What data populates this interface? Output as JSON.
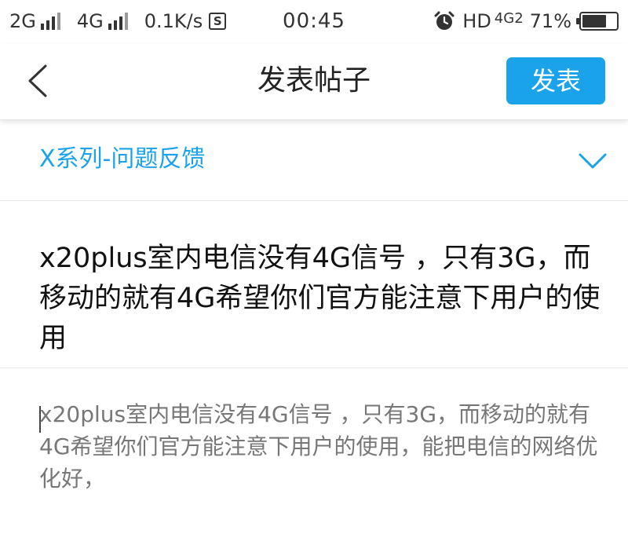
{
  "status_bar": {
    "network1": "2G",
    "network2": "4G",
    "speed": "0.1K/s",
    "s_badge": "S",
    "time": "00:45",
    "hd": "HD",
    "lte": "4G",
    "lte_sub": "2",
    "battery_percent": "71%",
    "battery_level": 0.71,
    "icons": [
      "signal-bars-icon",
      "alarm-clock-icon",
      "battery-icon"
    ]
  },
  "header": {
    "back_icon": "chevron-left-icon",
    "title": "发表帖子",
    "publish_label": "发表",
    "accent_color": "#1aa3ea"
  },
  "category": {
    "label": "X系列-问题反馈",
    "icon": "chevron-down-icon"
  },
  "post": {
    "title": "x20plus室内电信没有4G信号 ，只有3G，而移动的就有4G希望你们官方能注意下用户的使用",
    "body": "x20plus室内电信没有4G信号 ，只有3G，而移动的就有4G希望你们官方能注意下用户的使用，能把电信的网络优化好，"
  }
}
